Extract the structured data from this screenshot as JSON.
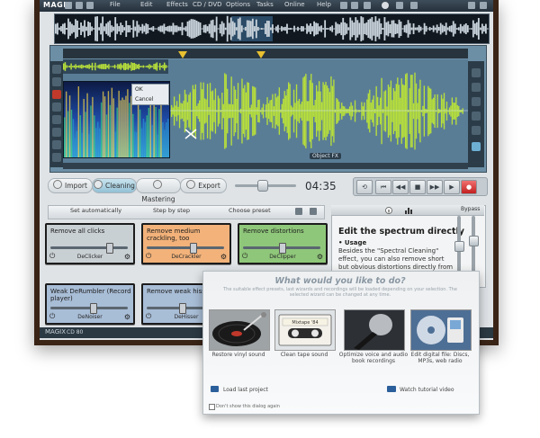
{
  "app": {
    "logo": "MAGIX"
  },
  "menu": [
    {
      "label": "File"
    },
    {
      "label": "Edit"
    },
    {
      "label": "Effects"
    },
    {
      "label": "CD / DVD"
    },
    {
      "label": "Options"
    },
    {
      "label": "Tasks"
    },
    {
      "label": "Online"
    },
    {
      "label": "Help"
    }
  ],
  "editor": {
    "context_menu": {
      "ok": "OK",
      "cancel": "Cancel"
    },
    "object_fx": "Object FX"
  },
  "tabs": [
    {
      "label": "Import"
    },
    {
      "label": "Cleaning"
    },
    {
      "label": "Mastering"
    },
    {
      "label": "Export"
    }
  ],
  "transport": {
    "time": "04:35"
  },
  "presetbar": {
    "set_auto": "Set automatically",
    "step_by_step": "Step by step",
    "choose_preset": "Choose preset"
  },
  "effects": [
    {
      "title": "Remove all clicks",
      "name": "DeClicker",
      "color": "#c9d0d4",
      "level": 0.78
    },
    {
      "title": "Remove medium crackling, too",
      "name": "DeCrackler",
      "color": "#f2b27a",
      "level": 0.6
    },
    {
      "title": "Remove distortions",
      "name": "DeClipper",
      "color": "#8fc77a",
      "level": 0.5
    },
    {
      "title": "Weak DeRumbler (Record player)",
      "name": "DeNoiser",
      "color": "#a8bdd6",
      "level": 0.55
    },
    {
      "title": "Remove weak hissing",
      "name": "DeHisser",
      "color": "#a8bdd6",
      "level": 0.45
    }
  ],
  "info": {
    "bypass": "Bypass",
    "title": "Edit the spectrum directly",
    "usage_heading": "• Usage",
    "text": "Besides the \"Spectral Cleaning\" effect, you can also remove short but obvious distortions directly from the audio material in the main track. The spectral editing mode has been"
  },
  "status": {
    "left": "MAGIX",
    "mid": "CD 80"
  },
  "dialog": {
    "title": "What would you like to do?",
    "subtitle": "The suitable effect presets, last wizards and recordings will be loaded depending on your selection. The selected wizard can be changed at any time.",
    "choices": [
      {
        "label": "Restore vinyl sound"
      },
      {
        "label": "Clean tape sound"
      },
      {
        "label": "Optimize voice and audio book recordings"
      },
      {
        "label": "Edit digital file: Discs, MP3s, web radio"
      }
    ],
    "cassette_label": "Mixtape '84",
    "load_last": "Load last project",
    "watch_tutorial": "Watch tutorial video",
    "dont_show": "Don't show this dialog again"
  },
  "colors": {
    "waveform": "#b8e03a",
    "editor_bg": "#6c8fa6",
    "record": "#d42a2a"
  }
}
